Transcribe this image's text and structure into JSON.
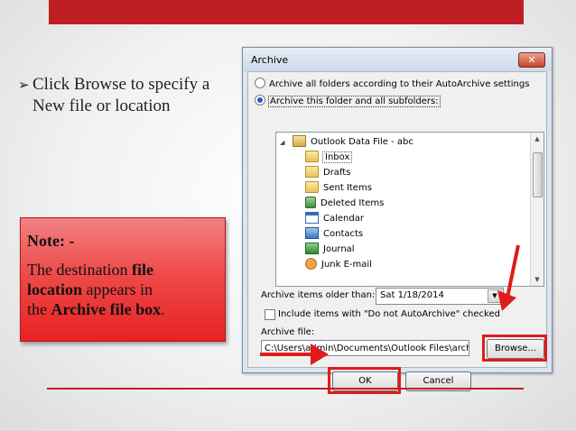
{
  "slide": {
    "bullet": "Click Browse to specify a New file or location",
    "note": {
      "title": "Note: -",
      "line1_pre": "The destination ",
      "line1_bold": "file",
      "line2_bold": "location",
      "line2_post": " appears in",
      "line3_pre": "the ",
      "line3_bold": "Archive file box",
      "line3_post": "."
    },
    "accent_color": "#bf1e24",
    "highlight_color": "#e01b1b"
  },
  "dialog": {
    "title": "Archive",
    "close_label": "✕",
    "radio_all": "Archive all folders according to their AutoArchive settings",
    "radio_this": "Archive this folder and all subfolders:",
    "radio_selected": "radio_this",
    "tree": {
      "root": "Outlook Data File - abc",
      "items": [
        {
          "label": "Inbox",
          "icon": "folder-icon",
          "selected": true
        },
        {
          "label": "Drafts",
          "icon": "drafts-folder-icon"
        },
        {
          "label": "Sent Items",
          "icon": "sent-folder-icon"
        },
        {
          "label": "Deleted Items",
          "icon": "trash-icon"
        },
        {
          "label": "Calendar",
          "icon": "calendar-icon"
        },
        {
          "label": "Contacts",
          "icon": "contacts-icon"
        },
        {
          "label": "Journal",
          "icon": "journal-icon"
        },
        {
          "label": "Junk E-mail",
          "icon": "junk-icon"
        }
      ]
    },
    "older_than_label": "Archive items older than:",
    "older_than_value": "Sat 1/18/2014",
    "include_label": "Include items with \"Do not AutoArchive\" checked",
    "include_checked": false,
    "archive_file_label": "Archive file:",
    "archive_file_value": "C:\\Users\\admin\\Documents\\Outlook Files\\archive",
    "browse_label": "Browse...",
    "ok_label": "OK",
    "cancel_label": "Cancel"
  }
}
